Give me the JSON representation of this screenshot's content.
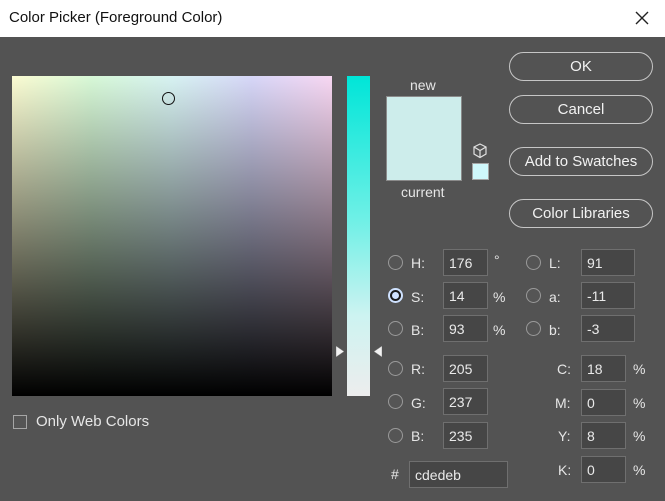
{
  "window": {
    "title": "Color Picker (Foreground Color)"
  },
  "buttons": {
    "ok": "OK",
    "cancel": "Cancel",
    "add_to_swatches": "Add to Swatches",
    "color_libraries": "Color Libraries"
  },
  "swatch": {
    "new_label": "new",
    "current_label": "current",
    "new_color": "#cdedeb",
    "current_color": "#cdedeb",
    "gamut_color": "#cff8fb"
  },
  "only_web_colors": {
    "label": "Only Web Colors",
    "checked": false
  },
  "fields": {
    "h": {
      "label": "H:",
      "value": "176",
      "unit": "°"
    },
    "s": {
      "label": "S:",
      "value": "14",
      "unit": "%"
    },
    "b": {
      "label": "B:",
      "value": "93",
      "unit": "%"
    },
    "r": {
      "label": "R:",
      "value": "205"
    },
    "g": {
      "label": "G:",
      "value": "237"
    },
    "bl": {
      "label": "B:",
      "value": "235"
    },
    "l": {
      "label": "L:",
      "value": "91"
    },
    "a": {
      "label": "a:",
      "value": "-11"
    },
    "lb": {
      "label": "b:",
      "value": "-3"
    },
    "c": {
      "label": "C:",
      "value": "18",
      "unit": "%"
    },
    "m": {
      "label": "M:",
      "value": "0",
      "unit": "%"
    },
    "y": {
      "label": "Y:",
      "value": "8",
      "unit": "%"
    },
    "k": {
      "label": "K:",
      "value": "0",
      "unit": "%"
    },
    "hex": {
      "label": "#",
      "value": "cdedeb"
    }
  },
  "selected_mode": "S",
  "hue_slider": {
    "top_color": "#00e5d8",
    "bottom_color": "#ededed"
  }
}
